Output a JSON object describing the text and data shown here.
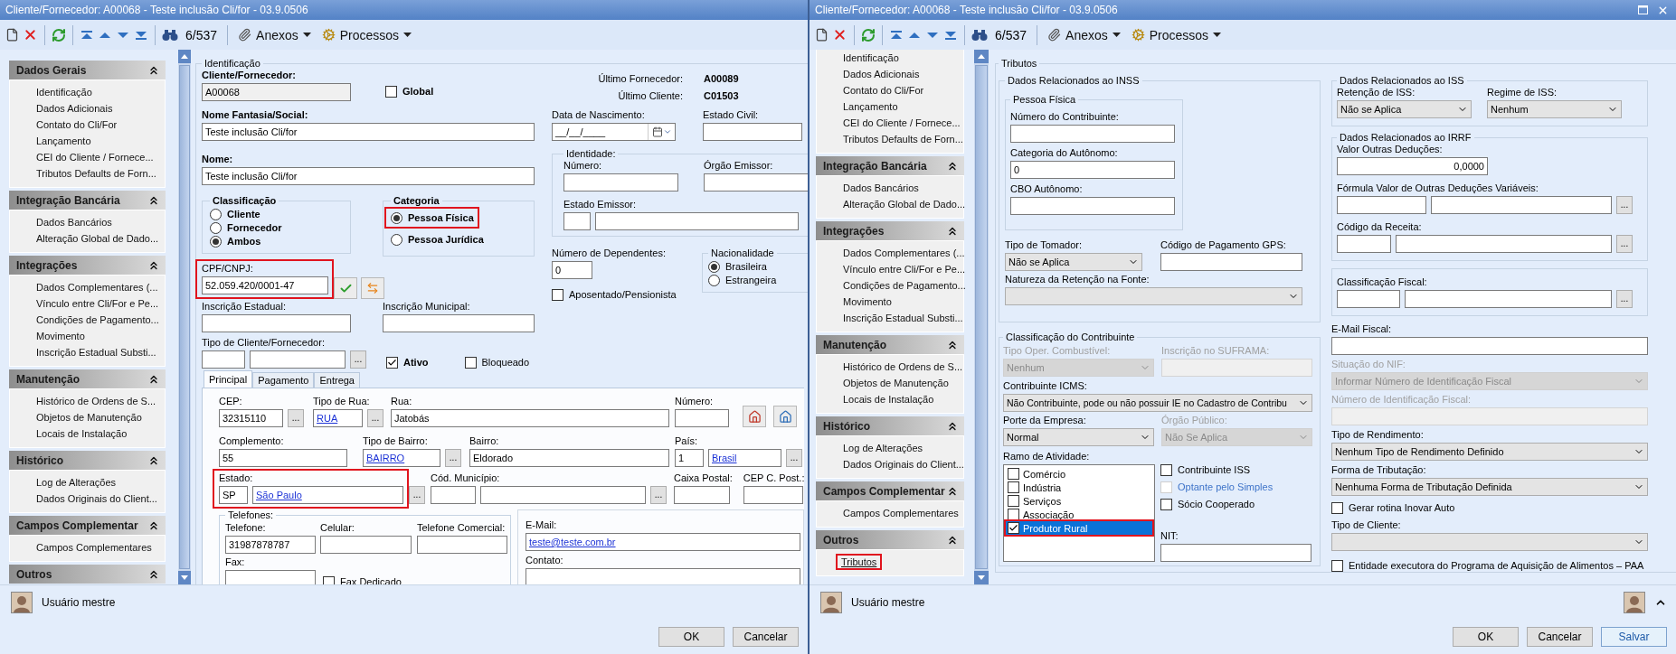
{
  "windows": [
    {
      "title": "Cliente/Fornecedor: A00068 - Teste inclusão Cli/for - 03.9.0506",
      "toolbar": {
        "counter": "6/537",
        "menus": [
          {
            "label": "Anexos"
          },
          {
            "label": "Processos"
          }
        ]
      },
      "sidebar": [
        {
          "title": "Dados Gerais",
          "items": [
            {
              "label": "Identificação",
              "selected": false,
              "highlighted": false
            },
            {
              "label": "Dados Adicionais",
              "selected": false,
              "highlighted": false
            },
            {
              "label": "Contato do Cli/For",
              "selected": false,
              "highlighted": false
            },
            {
              "label": "Lançamento",
              "selected": false,
              "highlighted": false
            },
            {
              "label": "CEI do Cliente / Fornece...",
              "selected": false,
              "highlighted": false
            },
            {
              "label": "Tributos Defaults de Forn...",
              "selected": false,
              "highlighted": false
            }
          ]
        },
        {
          "title": "Integração Bancária",
          "items": [
            {
              "label": "Dados Bancários",
              "selected": false,
              "highlighted": false
            },
            {
              "label": "Alteração Global de Dado...",
              "selected": false,
              "highlighted": false
            }
          ]
        },
        {
          "title": "Integrações",
          "items": [
            {
              "label": "Dados Complementares (...",
              "selected": false,
              "highlighted": false
            },
            {
              "label": "Vínculo entre Cli/For e Pe...",
              "selected": false,
              "highlighted": false
            },
            {
              "label": "Condições de Pagamento...",
              "selected": false,
              "highlighted": false
            },
            {
              "label": "Movimento",
              "selected": false,
              "highlighted": false
            },
            {
              "label": "Inscrição Estadual Substi...",
              "selected": false,
              "highlighted": false
            }
          ]
        },
        {
          "title": "Manutenção",
          "items": [
            {
              "label": "Histórico de Ordens de S...",
              "selected": false,
              "highlighted": false
            },
            {
              "label": "Objetos de Manutenção",
              "selected": false,
              "highlighted": false
            },
            {
              "label": "Locais de Instalação",
              "selected": false,
              "highlighted": false
            }
          ]
        },
        {
          "title": "Histórico",
          "items": [
            {
              "label": "Log de Alterações",
              "selected": false,
              "highlighted": false
            },
            {
              "label": "Dados Originais do Client...",
              "selected": false,
              "highlighted": false
            }
          ]
        },
        {
          "title": "Campos Complementar",
          "items": [
            {
              "label": "Campos Complementares",
              "selected": false,
              "highlighted": false
            }
          ]
        },
        {
          "title": "Outros"
        }
      ],
      "form": {
        "kind": "identification",
        "legend": "Identificação",
        "code": {
          "label": "Cliente/Fornecedor:",
          "value": "A00068",
          "readonly": true
        },
        "global": {
          "label": "Global",
          "checked": false
        },
        "last": [
          {
            "label": "Último Fornecedor:",
            "value": "A00089"
          },
          {
            "label": "Último Cliente:",
            "value": "C01503"
          }
        ],
        "trade_name": {
          "label": "Nome Fantasia/Social:",
          "value": "Teste inclusão Cli/for"
        },
        "name": {
          "label": "Nome:",
          "value": "Teste inclusão Cli/for"
        },
        "birth": {
          "label": "Data de Nascimento:",
          "value": "__/__/____"
        },
        "civil": {
          "label": "Estado Civil:"
        },
        "identity": {
          "legend": "Identidade:",
          "number": {
            "label": "Número:"
          },
          "issuer": {
            "label": "Órgão Emissor:"
          },
          "issuer_state": {
            "label": "Estado Emissor:"
          }
        },
        "classification": {
          "legend": "Classificação",
          "options": [
            {
              "label": "Cliente",
              "selected": false
            },
            {
              "label": "Fornecedor",
              "selected": false
            },
            {
              "label": "Ambos",
              "selected": true
            }
          ]
        },
        "category": {
          "legend": "Categoria",
          "options": [
            {
              "label": "Pessoa Física",
              "selected": true,
              "highlighted": true
            },
            {
              "label": "Pessoa Jurídica",
              "selected": false,
              "highlighted": false
            }
          ]
        },
        "dependents": {
          "label": "Número de Dependentes:",
          "value": "0"
        },
        "retired": {
          "label": "Aposentado/Pensionista",
          "checked": false
        },
        "nationality": {
          "legend": "Nacionalidade",
          "options": [
            {
              "label": "Brasileira",
              "selected": true
            },
            {
              "label": "Estrangeira",
              "selected": false
            }
          ]
        },
        "cpf": {
          "label": "CPF/CNPJ:",
          "value": "52.059.420/0001-47",
          "highlighted": true
        },
        "state_reg": {
          "label": "Inscrição Estadual:"
        },
        "city_reg": {
          "label": "Inscrição Municipal:"
        },
        "type": {
          "label": "Tipo de Cliente/Fornecedor:",
          "button": "..."
        },
        "active": {
          "label": "Ativo",
          "checked": true
        },
        "blocked": {
          "label": "Bloqueado",
          "checked": false
        },
        "tabs": [
          {
            "label": "Principal",
            "selected": true
          },
          {
            "label": "Pagamento",
            "selected": false
          },
          {
            "label": "Entrega",
            "selected": false
          }
        ],
        "address": {
          "cep": {
            "label": "CEP:",
            "value": "32315110",
            "button": "..."
          },
          "street_type": {
            "label": "Tipo de Rua:",
            "value": "RUA",
            "button": "..."
          },
          "street": {
            "label": "Rua:",
            "value": "Jatobás"
          },
          "number": {
            "label": "Número:"
          },
          "complement": {
            "label": "Complemento:",
            "value": "55"
          },
          "district_type": {
            "label": "Tipo de Bairro:",
            "value": "BAIRRO",
            "button": "..."
          },
          "district": {
            "label": "Bairro:",
            "value": "Eldorado"
          },
          "country": {
            "label": "País:",
            "code": "1",
            "value": "Brasil",
            "button": "..."
          },
          "state": {
            "label": "Estado:",
            "code": "SP",
            "value": "São Paulo",
            "button": "...",
            "highlighted": true
          },
          "city": {
            "label": "Cód. Município:",
            "button": "..."
          },
          "po_box": {
            "label": "Caixa Postal:"
          },
          "po_cep": {
            "label": "CEP C. Post.:"
          }
        },
        "phones": {
          "legend": "Telefones:",
          "phone": {
            "label": "Telefone:",
            "value": "31987878787"
          },
          "mobile": {
            "label": "Celular:"
          },
          "work": {
            "label": "Telefone Comercial:"
          },
          "fax": {
            "label": "Fax:"
          },
          "fax_dedicated": {
            "label": "Fax Dedicado",
            "checked": false
          }
        },
        "email": {
          "label": "E-Mail:",
          "value": "teste@teste.com.br"
        },
        "contact": {
          "label": "Contato:"
        }
      },
      "user": {
        "name": "Usuário mestre"
      },
      "buttons": [
        {
          "label": "OK"
        },
        {
          "label": "Cancelar"
        }
      ]
    },
    {
      "title": "Cliente/Fornecedor: A00068 - Teste inclusão Cli/for - 03.9.0506",
      "toolbar": {
        "counter": "6/537",
        "menus": [
          {
            "label": "Anexos"
          },
          {
            "label": "Processos"
          }
        ]
      },
      "sidebar": [
        {
          "items": [
            {
              "label": "Identificação",
              "selected": false,
              "highlighted": false
            },
            {
              "label": "Dados Adicionais",
              "selected": false,
              "highlighted": false
            },
            {
              "label": "Contato do Cli/For",
              "selected": false,
              "highlighted": false
            },
            {
              "label": "Lançamento",
              "selected": false,
              "highlighted": false
            },
            {
              "label": "CEI do Cliente / Fornece...",
              "selected": false,
              "highlighted": false
            },
            {
              "label": "Tributos Defaults de Forn...",
              "selected": false,
              "highlighted": false
            }
          ]
        },
        {
          "title": "Integração Bancária",
          "items": [
            {
              "label": "Dados Bancários",
              "selected": false,
              "highlighted": false
            },
            {
              "label": "Alteração Global de Dado...",
              "selected": false,
              "highlighted": false
            }
          ]
        },
        {
          "title": "Integrações",
          "items": [
            {
              "label": "Dados Complementares (...",
              "selected": false,
              "highlighted": false
            },
            {
              "label": "Vínculo entre Cli/For e Pe...",
              "selected": false,
              "highlighted": false
            },
            {
              "label": "Condições de Pagamento...",
              "selected": false,
              "highlighted": false
            },
            {
              "label": "Movimento",
              "selected": false,
              "highlighted": false
            },
            {
              "label": "Inscrição Estadual Substi...",
              "selected": false,
              "highlighted": false
            }
          ]
        },
        {
          "title": "Manutenção",
          "items": [
            {
              "label": "Histórico de Ordens de S...",
              "selected": false,
              "highlighted": false
            },
            {
              "label": "Objetos de Manutenção",
              "selected": false,
              "highlighted": false
            },
            {
              "label": "Locais de Instalação",
              "selected": false,
              "highlighted": false
            }
          ]
        },
        {
          "title": "Histórico",
          "items": [
            {
              "label": "Log de Alterações",
              "selected": false,
              "highlighted": false
            },
            {
              "label": "Dados Originais do Client...",
              "selected": false,
              "highlighted": false
            }
          ]
        },
        {
          "title": "Campos Complementar",
          "items": [
            {
              "label": "Campos Complementares",
              "selected": false,
              "highlighted": false
            }
          ]
        },
        {
          "title": "Outros",
          "items": [
            {
              "label": "Tributos",
              "selected": true,
              "highlighted": true
            }
          ]
        }
      ],
      "form": {
        "kind": "taxes",
        "legend": "Tributos",
        "inss": {
          "legend": "Dados Relacionados ao INSS",
          "person": {
            "legend": "Pessoa Física",
            "number": {
              "label": "Número do Contribuinte:"
            },
            "category": {
              "label": "Categoria do Autônomo:",
              "value": "0"
            },
            "cbo": {
              "label": "CBO Autônomo:"
            }
          },
          "taker": {
            "label": "Tipo de Tomador:",
            "value": "Não se Aplica"
          },
          "gps": {
            "label": "Código de Pagamento GPS:"
          },
          "withholding": {
            "label": "Natureza da Retenção na Fonte:"
          }
        },
        "classification": {
          "legend": "Classificação do Contribuinte",
          "fuel": {
            "label": "Tipo Oper. Combustível:",
            "value": "Nenhum",
            "disabled": true
          },
          "suframa": {
            "label": "Inscrição no SUFRAMA:",
            "disabled": true
          },
          "icms": {
            "label": "Contribuinte ICMS:",
            "value": "Não Contribuinte, pode ou não possuir IE no Cadastro de Contribu"
          },
          "size": {
            "label": "Porte da Empresa:",
            "value": "Normal"
          },
          "public": {
            "label": "Órgão Público:",
            "value": "Não Se Aplica",
            "disabled": true
          },
          "activity": {
            "label": "Ramo de Atividade:",
            "items": [
              {
                "label": "Comércio",
                "checked": false,
                "selected": false,
                "highlighted": false
              },
              {
                "label": "Indústria",
                "checked": false,
                "selected": false,
                "highlighted": false
              },
              {
                "label": "Serviços",
                "checked": false,
                "selected": false,
                "highlighted": false
              },
              {
                "label": "Associação",
                "checked": false,
                "selected": false,
                "highlighted": false
              },
              {
                "label": "Produtor Rural",
                "checked": true,
                "selected": true,
                "highlighted": true
              }
            ]
          },
          "flags": [
            {
              "label": "Contribuinte ISS",
              "checked": false,
              "disabled": false
            },
            {
              "label": "Optante pelo Simples",
              "checked": false,
              "disabled": true
            },
            {
              "label": "Sócio Cooperado",
              "checked": false,
              "disabled": false
            }
          ],
          "nit": {
            "label": "NIT:"
          }
        },
        "iss": {
          "legend": "Dados Relacionados ao ISS",
          "retention": {
            "label": "Retenção de ISS:",
            "value": "Não se Aplica"
          },
          "regime": {
            "label": "Regime de ISS:",
            "value": "Nenhum"
          }
        },
        "irrf": {
          "legend": "Dados Relacionados ao IRRF",
          "deductions": {
            "label": "Valor Outras Deduções:",
            "value": "0,0000"
          },
          "formula": {
            "label": "Fórmula Valor de Outras Deduções Variáveis:",
            "button": "..."
          },
          "revenue": {
            "label": "Código da Receita:",
            "button": "..."
          }
        },
        "fiscal_class": {
          "label": "Classificação Fiscal:",
          "button": "..."
        },
        "fiscal_email": {
          "label": "E-Mail Fiscal:"
        },
        "nif_status": {
          "label": "Situação do NIF:",
          "value": "Informar Número de Identificação Fiscal",
          "disabled": true
        },
        "nif": {
          "label": "Número de Identificação Fiscal:",
          "disabled": true
        },
        "income": {
          "label": "Tipo de Rendimento:",
          "value": "Nenhum Tipo de Rendimento Definido"
        },
        "taxation": {
          "label": "Forma de Tributação:",
          "value": "Nenhuma Forma de Tributação Definida"
        },
        "inovar": {
          "label": "Gerar rotina Inovar Auto",
          "checked": false
        },
        "client_type": {
          "label": "Tipo de Cliente:"
        },
        "paa": {
          "label": "Entidade executora do Programa de Aquisição de Alimentos – PAA",
          "checked": false
        }
      },
      "user": {
        "name": "Usuário mestre"
      },
      "buttons": [
        {
          "label": "OK"
        },
        {
          "label": "Cancelar"
        },
        {
          "label": "Salvar"
        }
      ]
    }
  ]
}
